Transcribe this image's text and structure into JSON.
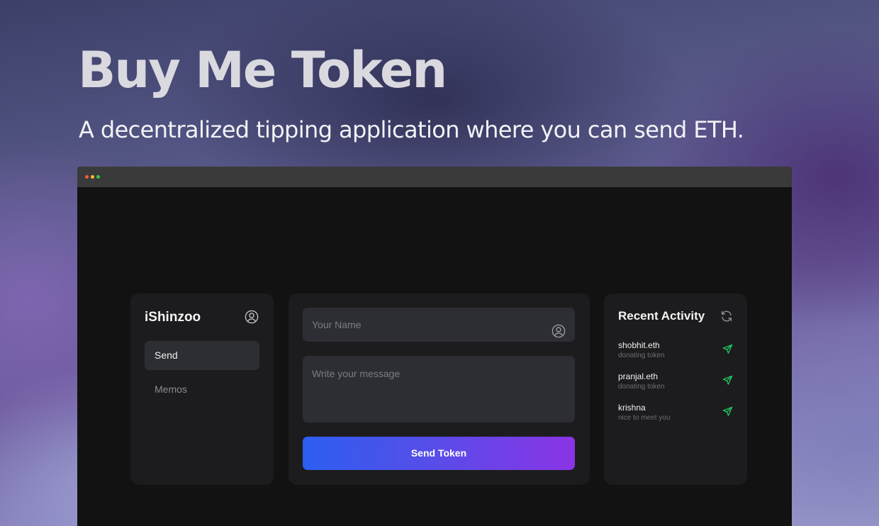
{
  "hero": {
    "title": "Buy Me Token",
    "subtitle": "A decentralized tipping application where you can send ETH."
  },
  "window": {
    "controls": [
      "close",
      "minimize",
      "maximize"
    ]
  },
  "sidebar": {
    "user_name": "iShinzoo",
    "user_icon": "user-circle-icon",
    "items": [
      {
        "label": "Send",
        "active": true
      },
      {
        "label": "Memos",
        "active": false
      }
    ]
  },
  "form": {
    "name_placeholder": "Your Name",
    "name_icon": "user-circle-icon",
    "message_placeholder": "Write your message",
    "submit_label": "Send Token"
  },
  "activity": {
    "title": "Recent Activity",
    "refresh_icon": "refresh-icon",
    "items": [
      {
        "name": "shobhit.eth",
        "message": "donating token",
        "icon": "send-icon"
      },
      {
        "name": "pranjal.eth",
        "message": "donating token",
        "icon": "send-icon"
      },
      {
        "name": "krishna",
        "message": "nice to meet you",
        "icon": "send-icon"
      }
    ]
  },
  "colors": {
    "accent_start": "#2c5ff0",
    "accent_end": "#8a34e6",
    "activity_icon": "#22c55e",
    "panel_bg": "#1c1c1e",
    "app_bg": "#121212"
  }
}
